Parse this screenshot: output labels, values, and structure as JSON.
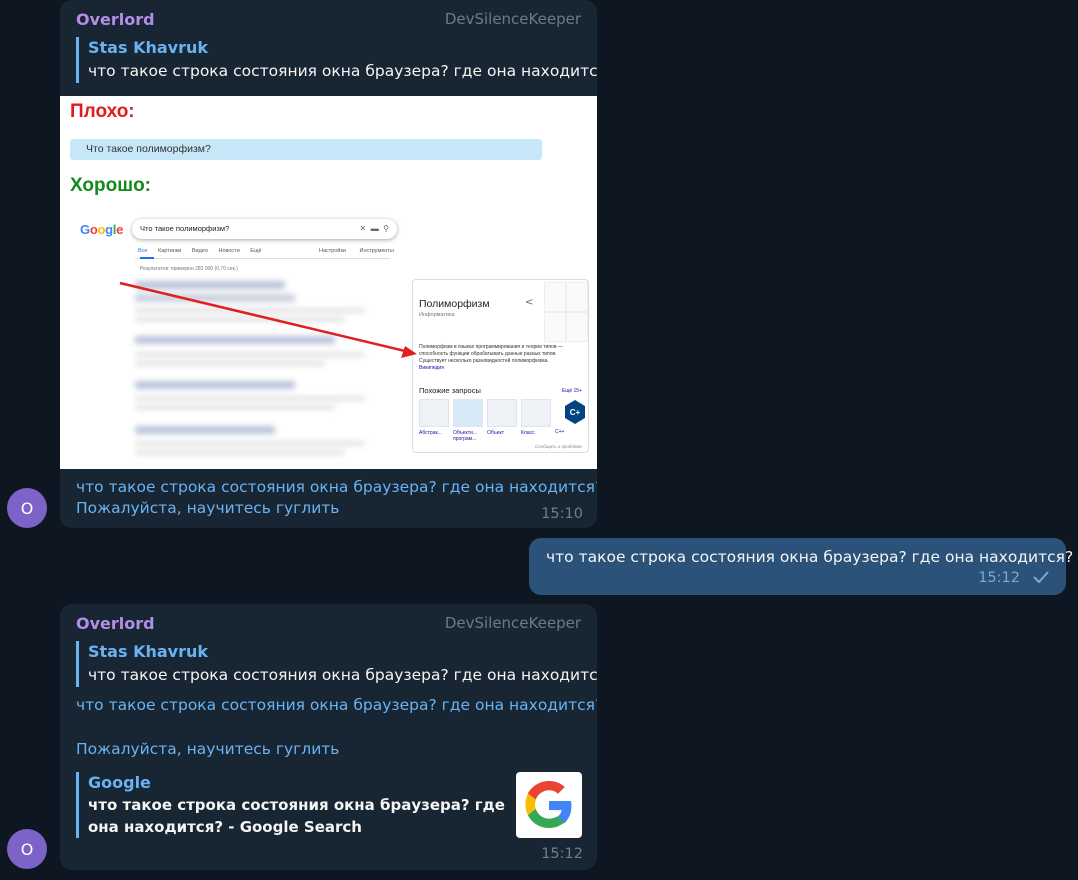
{
  "messages": [
    {
      "sender": "Overlord",
      "role": "DevSilenceKeeper",
      "reply": {
        "name": "Stas Khavruk",
        "text": "что такое строка состояния окна браузера? где она находится?"
      },
      "image": {
        "bad_label": "Плохо:",
        "bad_query": "Что такое полиморфизм?",
        "good_label": "Хорошо:",
        "google": {
          "logo": "Google",
          "query": "Что такое полиморфизм?",
          "tabs": [
            "Все",
            "Картинки",
            "Видео",
            "Новости",
            "Ещё"
          ],
          "tools": [
            "Настройки",
            "Инструменты"
          ],
          "stats": "Результатов: примерно 282 000 (0,70 сек.)",
          "panel": {
            "title": "Полиморфизм",
            "subtitle": "Информатика",
            "description": "Полиморфизм в языках программирования и теории типов — способность функции обрабатывать данные разных типов. Существует несколько разновидностей полиморфизма.",
            "source": "Википедия",
            "related_title": "Похожие запросы",
            "related_more": "Ещё 15+",
            "related": [
              "Абстрак...",
              "Объекти... програм...",
              "Объект",
              "Класс",
              "C++"
            ],
            "footer": "Сообщить о проблеме"
          }
        }
      },
      "link_lines": [
        "что такое строка состояния окна браузера? где она находится?",
        "Пожалуйста, научитесь гуглить"
      ],
      "time": "15:10",
      "avatar": "O"
    },
    {
      "outgoing": true,
      "text": "что такое строка состояния окна браузера? где она находится?",
      "time": "15:12"
    },
    {
      "sender": "Overlord",
      "role": "DevSilenceKeeper",
      "reply": {
        "name": "Stas Khavruk",
        "text": "что такое строка состояния окна браузера? где она находится?"
      },
      "link_lines": [
        "что такое строка состояния окна браузера? где она находится?",
        "Пожалуйста, научитесь гуглить"
      ],
      "preview": {
        "site": "Google",
        "title": "что такое строка состояния окна браузера? где она находится? - Google Search"
      },
      "time": "15:12",
      "avatar": "O"
    }
  ],
  "colors": {
    "background": "#0e1621",
    "incoming_bubble": "#182533",
    "outgoing_bubble": "#2b5278",
    "sender_name": "#b28ee8",
    "link": "#6ab3f3",
    "avatar": "#7d63c7"
  }
}
